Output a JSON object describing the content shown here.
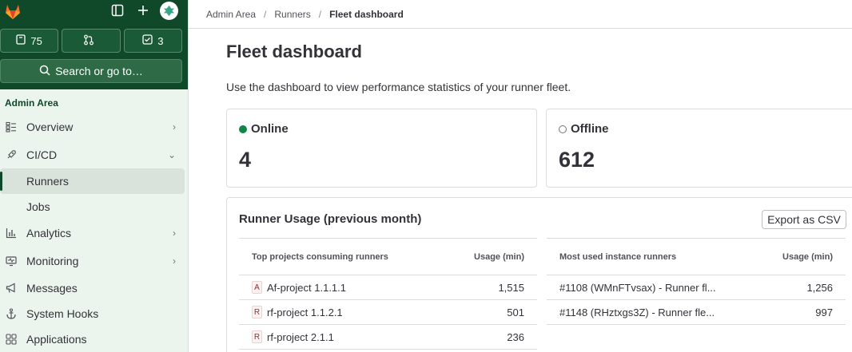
{
  "sidebar": {
    "counts": {
      "issues": "75",
      "merge_requests": "",
      "todos": "3"
    },
    "search_label": "Search or go to…",
    "section_label": "Admin Area",
    "items": [
      {
        "label": "Overview"
      },
      {
        "label": "CI/CD"
      },
      {
        "label": "Runners"
      },
      {
        "label": "Jobs"
      },
      {
        "label": "Analytics"
      },
      {
        "label": "Monitoring"
      },
      {
        "label": "Messages"
      },
      {
        "label": "System Hooks"
      },
      {
        "label": "Applications"
      }
    ]
  },
  "breadcrumb": [
    "Admin Area",
    "Runners",
    "Fleet dashboard"
  ],
  "page": {
    "title": "Fleet dashboard",
    "description": "Use the dashboard to view performance statistics of your runner fleet."
  },
  "stats": {
    "online_label": "Online",
    "online_value": "4",
    "offline_label": "Offline",
    "offline_value": "612"
  },
  "usage": {
    "title": "Runner Usage (previous month)",
    "export_label": "Export as CSV",
    "projects": {
      "header_name": "Top projects consuming runners",
      "header_usage": "Usage (min)",
      "rows": [
        {
          "badge": "A",
          "name": "Af-project 1.1.1.1",
          "usage": "1,515"
        },
        {
          "badge": "R",
          "name": "rf-project 1.1.2.1",
          "usage": "501"
        },
        {
          "badge": "R",
          "name": "rf-project 2.1.1",
          "usage": "236"
        }
      ]
    },
    "runners": {
      "header_name": "Most used instance runners",
      "header_usage": "Usage (min)",
      "rows": [
        {
          "name": "#1108 (WMnFTvsax) - Runner fl...",
          "usage": "1,256"
        },
        {
          "name": "#1148 (RHztxgs3Z) - Runner fle...",
          "usage": "997"
        }
      ]
    }
  },
  "colors": {
    "sidebar_top": "#10482a",
    "online_dot": "#108548",
    "offline_dot": "#737278"
  }
}
